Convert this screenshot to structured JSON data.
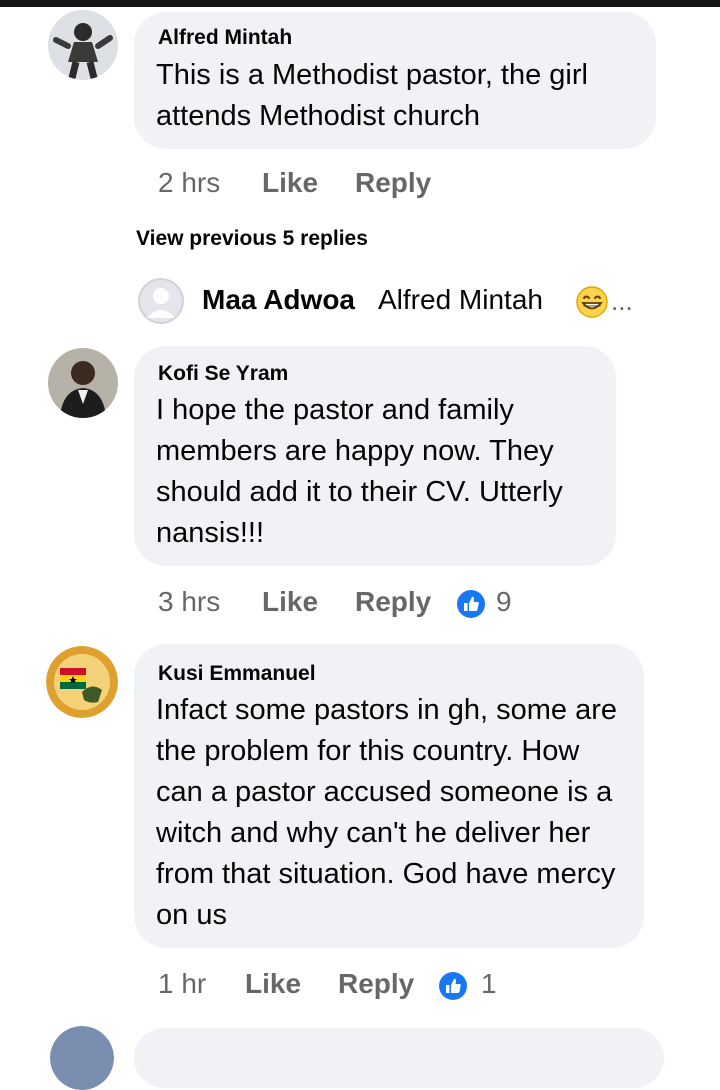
{
  "comments": [
    {
      "author": "Alfred Mintah",
      "text": "This is a Methodist pastor,  the girl attends Methodist church",
      "time": "2 hrs",
      "like_label": "Like",
      "reply_label": "Reply"
    },
    {
      "author": "Kofi Se Yram",
      "text": "I hope the pastor and family members are happy now. They should add it to their CV. Utterly nansis!!!",
      "time": "3 hrs",
      "like_label": "Like",
      "reply_label": "Reply",
      "reaction_count": "9"
    },
    {
      "author": "Kusi Emmanuel",
      "text": "Infact some pastors in gh, some are the problem for this country. How can a pastor accused someone is a witch and why can't he deliver her from that situation. God have mercy on us",
      "time": "1 hr",
      "like_label": "Like",
      "reply_label": "Reply",
      "reaction_count": "1"
    }
  ],
  "replies_thread": {
    "view_previous_label": "View previous 5 replies",
    "preview": {
      "author": "Maa Adwoa",
      "text": "Alfred Mintah",
      "emoji": "grinning-face-with-smiling-eyes",
      "ellipsis": "..."
    }
  },
  "colors": {
    "bubble": "#f0f2f5",
    "meta": "#65676b",
    "like_badge": "#1877f2"
  }
}
